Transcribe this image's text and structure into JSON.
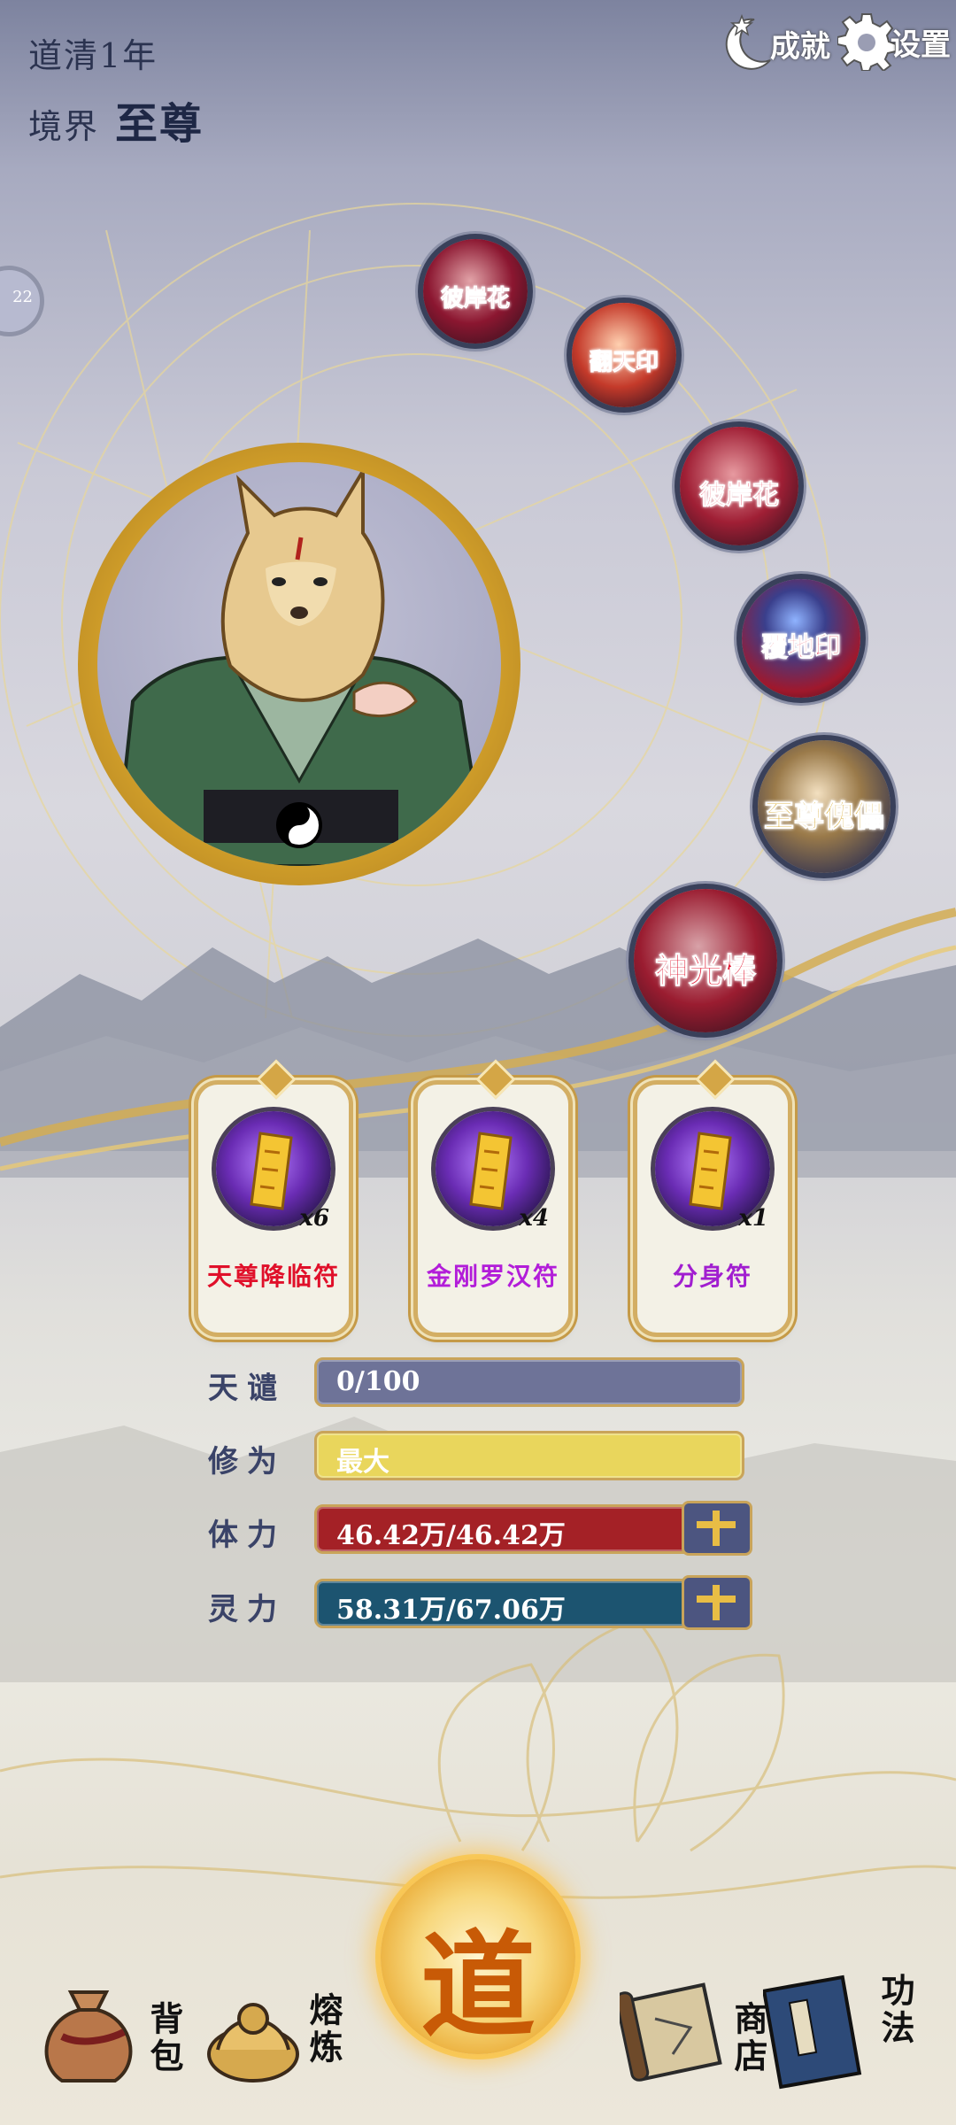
{
  "header": {
    "dao_label": "道清1年",
    "realm_label": "境界",
    "realm_value": "至尊",
    "achievement_label": "成就",
    "settings_label": "设置",
    "side_badge": "22"
  },
  "equipment": [
    {
      "name": "彼岸花",
      "icon": "red-flower-orb-icon"
    },
    {
      "name": "翻天印",
      "icon": "seal-icon"
    },
    {
      "name": "彼岸花",
      "icon": "red-flower-orb-icon"
    },
    {
      "name": "覆地印",
      "icon": "blue-orb-seal-icon"
    },
    {
      "name": "至尊傀儡",
      "icon": "puppet-icon"
    },
    {
      "name": "神光棒",
      "icon": "staff-icon"
    }
  ],
  "talismans": [
    {
      "name": "天尊降临符",
      "count": "x6",
      "color": "#e0102a"
    },
    {
      "name": "金刚罗汉符",
      "count": "x4",
      "color": "#b21dd9"
    },
    {
      "name": "分身符",
      "count": "x1",
      "color": "#a11ed0"
    }
  ],
  "stats": {
    "tianqian": {
      "label": "天谴",
      "value": "0/100",
      "fill": 0
    },
    "xiuwei": {
      "label": "修为",
      "value": "最大",
      "fill": 1
    },
    "tili": {
      "label": "体力",
      "value": "46.42万/46.42万",
      "fill": 1
    },
    "lingli": {
      "label": "灵力",
      "value": "58.31万/67.06万",
      "fill": 0.87
    }
  },
  "nav": {
    "bag": "背包",
    "refine": "熔炼",
    "dao": "道",
    "shop": "商店",
    "skills": "功法"
  },
  "colors": {
    "xiuwei_bar": "#e9d65c",
    "tili_bar": "#a42126",
    "lingli_bar": "#1c5470",
    "tianqian_bar": "#6e7398"
  }
}
